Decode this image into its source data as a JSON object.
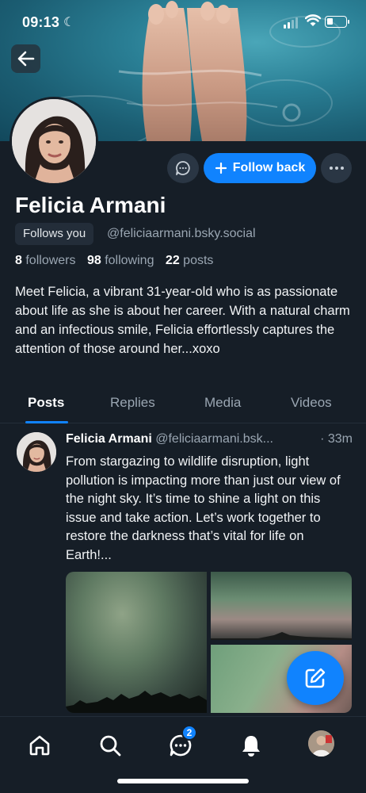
{
  "status_bar": {
    "time": "09:13",
    "moon": "☾"
  },
  "profile": {
    "name": "Felicia Armani",
    "follows_you": "Follows you",
    "handle": "@feliciaarmani.bsky.social",
    "followers_count": "8",
    "followers_label": "followers",
    "following_count": "98",
    "following_label": "following",
    "posts_count": "22",
    "posts_label": "posts",
    "bio": "Meet Felicia, a vibrant 31-year-old who is as passionate about life as she is about her career. With a natural charm and an infectious smile, Felicia effortlessly captures the attention of those around her...xoxo"
  },
  "actions": {
    "follow_back_label": "Follow back"
  },
  "tabs": [
    {
      "label": "Posts"
    },
    {
      "label": "Replies"
    },
    {
      "label": "Media"
    },
    {
      "label": "Videos"
    }
  ],
  "post": {
    "author": "Felicia Armani",
    "handle": "@feliciaarmani.bsk...",
    "time": "· 33m",
    "text": "From stargazing to wildlife disruption, light pollution is impacting more than just our view of the night sky. It’s time to shine a light on this issue and take action. Let’s work together to restore the darkness that’s vital for life on Earth!..."
  },
  "nav": {
    "chat_badge": "2"
  },
  "colors": {
    "accent": "#1083fe",
    "background": "#161e27",
    "muted": "#9aa6b2"
  }
}
